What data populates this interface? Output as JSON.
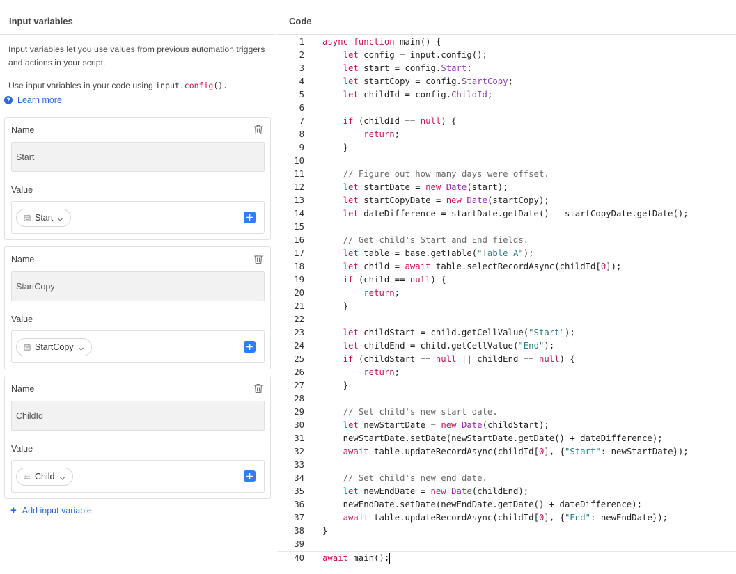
{
  "left_panel": {
    "title": "Input variables",
    "desc1": "Input variables let you use values from previous automation triggers and actions in your script.",
    "desc2_prefix": "Use input variables in your code using ",
    "desc2_code_obj": "input.",
    "desc2_code_fn": "config",
    "desc2_code_tail": "().",
    "learn_more": "Learn more",
    "variables": [
      {
        "name_label": "Name",
        "name": "Start",
        "value_label": "Value",
        "value_pill": "Start",
        "field_icon": "calendar-icon"
      },
      {
        "name_label": "Name",
        "name": "StartCopy",
        "value_label": "Value",
        "value_pill": "StartCopy",
        "field_icon": "calendar-icon"
      },
      {
        "name_label": "Name",
        "name": "ChildId",
        "value_label": "Value",
        "value_pill": "Child",
        "field_icon": "link-field-icon"
      }
    ],
    "add_variable": "Add input variable"
  },
  "code_panel": {
    "title": "Code",
    "active_line": 40,
    "lines": [
      "async function main() {",
      "    let config = input.config();",
      "    let start = config.Start;",
      "    let startCopy = config.StartCopy;",
      "    let childId = config.ChildId;",
      "",
      "    if (childId == null) {",
      "        return;",
      "    }",
      "",
      "    // Figure out how many days were offset.",
      "    let startDate = new Date(start);",
      "    let startCopyDate = new Date(startCopy);",
      "    let dateDifference = startDate.getDate() - startCopyDate.getDate();",
      "",
      "    // Get child's Start and End fields.",
      "    let table = base.getTable(\"Table A\");",
      "    let child = await table.selectRecordAsync(childId[0]);",
      "    if (child == null) {",
      "        return;",
      "    }",
      "",
      "    let childStart = child.getCellValue(\"Start\");",
      "    let childEnd = child.getCellValue(\"End\");",
      "    if (childStart == null || childEnd == null) {",
      "        return;",
      "    }",
      "",
      "    // Set child's new start date.",
      "    let newStartDate = new Date(childStart);",
      "    newStartDate.setDate(newStartDate.getDate() + dateDifference);",
      "    await table.updateRecordAsync(childId[0], {\"Start\": newStartDate});",
      "",
      "    // Set child's new end date.",
      "    let newEndDate = new Date(childEnd);",
      "    newEndDate.setDate(newEndDate.getDate() + dateDifference);",
      "    await table.updateRecordAsync(childId[0], {\"End\": newEndDate});",
      "}",
      "",
      "await main();"
    ]
  },
  "colors": {
    "accent": "#2d7ff9",
    "link": "#2b6ad8",
    "keyword": "#c2185b",
    "type": "#9c27b0",
    "string": "#2e7d87",
    "comment": "#6b6b6b"
  }
}
